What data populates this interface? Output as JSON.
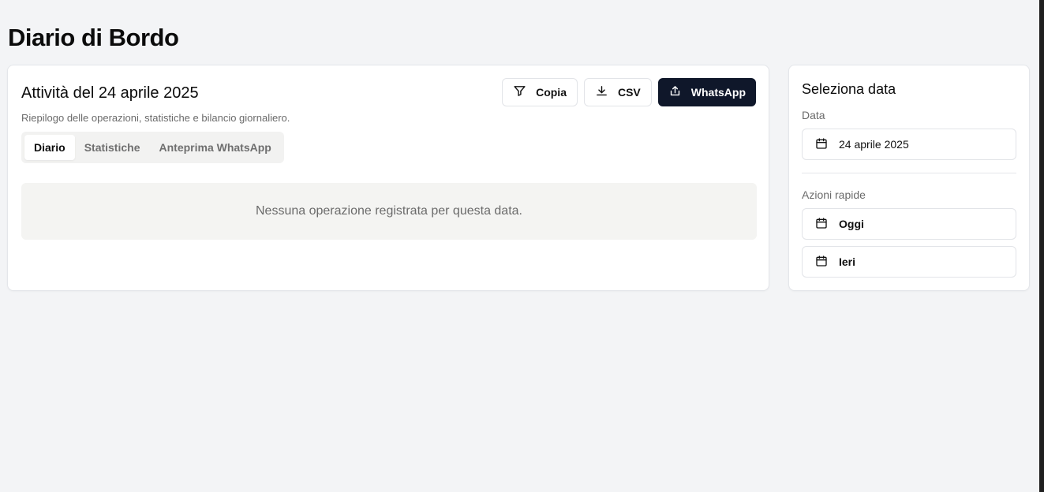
{
  "page": {
    "title": "Diario di Bordo"
  },
  "main": {
    "title": "Attività del 24 aprile 2025",
    "subtitle": "Riepilogo delle operazioni, statistiche e bilancio giornaliero.",
    "actions": {
      "copy": {
        "label": "Copia",
        "icon": "filter-icon"
      },
      "csv": {
        "label": "CSV",
        "icon": "download-icon"
      },
      "whatsapp": {
        "label": "WhatsApp",
        "icon": "share-icon"
      }
    },
    "tabs": [
      {
        "label": "Diario",
        "active": true
      },
      {
        "label": "Statistiche",
        "active": false
      },
      {
        "label": "Anteprima WhatsApp",
        "active": false
      }
    ],
    "empty_message": "Nessuna operazione registrata per questa data."
  },
  "sidebar": {
    "title": "Seleziona data",
    "date_label": "Data",
    "date_value": "24 aprile 2025",
    "quick_label": "Azioni rapide",
    "quick_actions": [
      {
        "label": "Oggi",
        "icon": "calendar-icon"
      },
      {
        "label": "Ieri",
        "icon": "calendar-icon"
      }
    ]
  },
  "colors": {
    "background": "#f3f4f6",
    "primary_button": "#0f172a",
    "muted_text": "#6b6b6b"
  }
}
